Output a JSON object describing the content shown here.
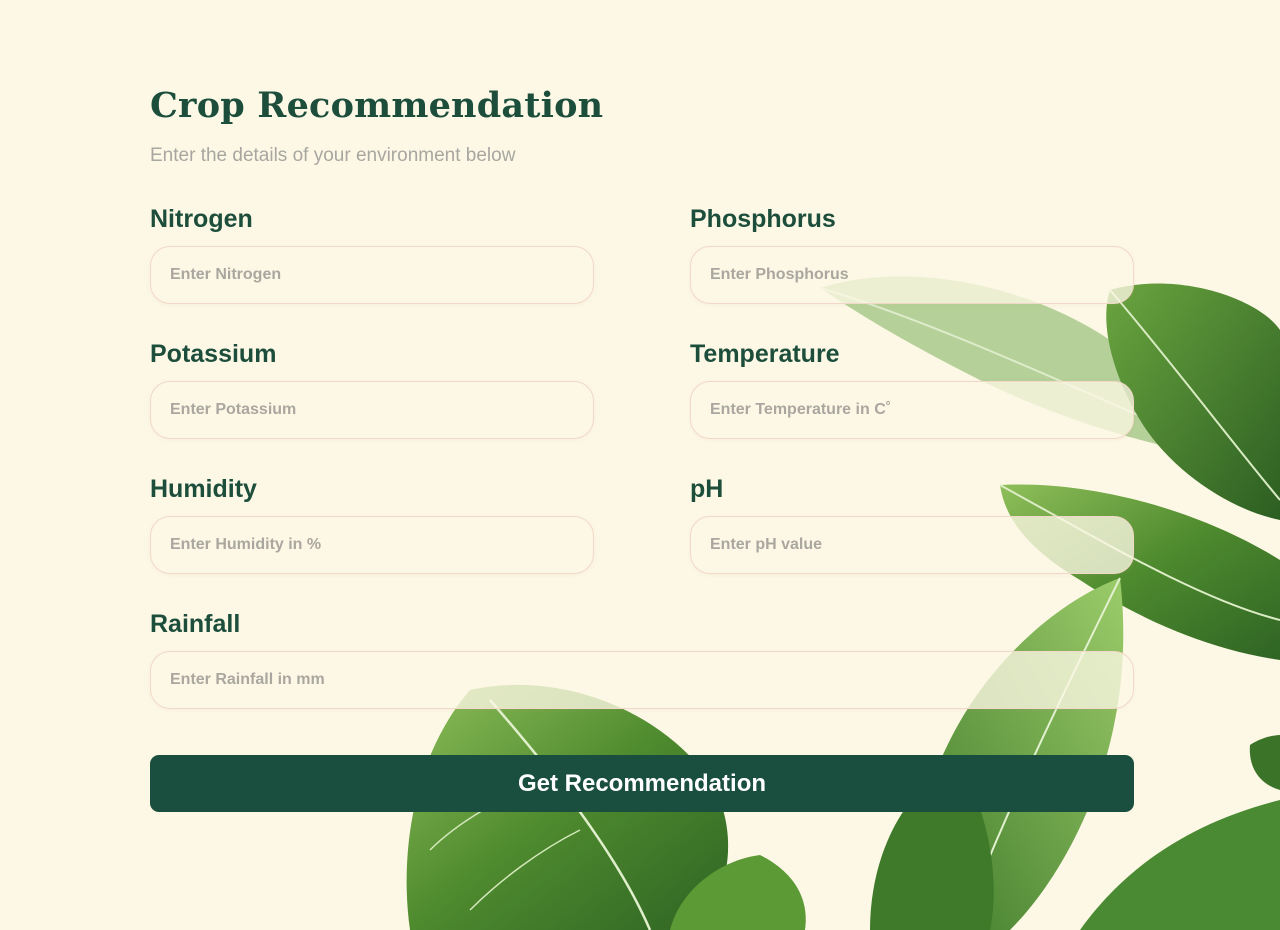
{
  "header": {
    "title": "Crop Recommendation",
    "subtitle": "Enter the details of your environment below"
  },
  "fields": [
    {
      "label": "Nitrogen",
      "placeholder": "Enter Nitrogen",
      "value": ""
    },
    {
      "label": "Phosphorus",
      "placeholder": "Enter Phosphorus",
      "value": ""
    },
    {
      "label": "Potassium",
      "placeholder": "Enter Potassium",
      "value": ""
    },
    {
      "label": "Temperature",
      "placeholder": "Enter Temperature in C˚",
      "value": ""
    },
    {
      "label": "Humidity",
      "placeholder": "Enter Humidity in %",
      "value": ""
    },
    {
      "label": "pH",
      "placeholder": "Enter pH value",
      "value": ""
    },
    {
      "label": "Rainfall",
      "placeholder": "Enter Rainfall in mm",
      "value": ""
    }
  ],
  "submit": {
    "label": "Get Recommendation"
  },
  "colors": {
    "background": "#fdf8e6",
    "primary": "#1a4e3e",
    "label": "#1c4e3b",
    "muted": "#a7a7a0",
    "input_border": "#f2d8c8",
    "leaf": "#3f7a2a"
  },
  "decoration": {
    "background_image": "green-leaves-plant"
  }
}
